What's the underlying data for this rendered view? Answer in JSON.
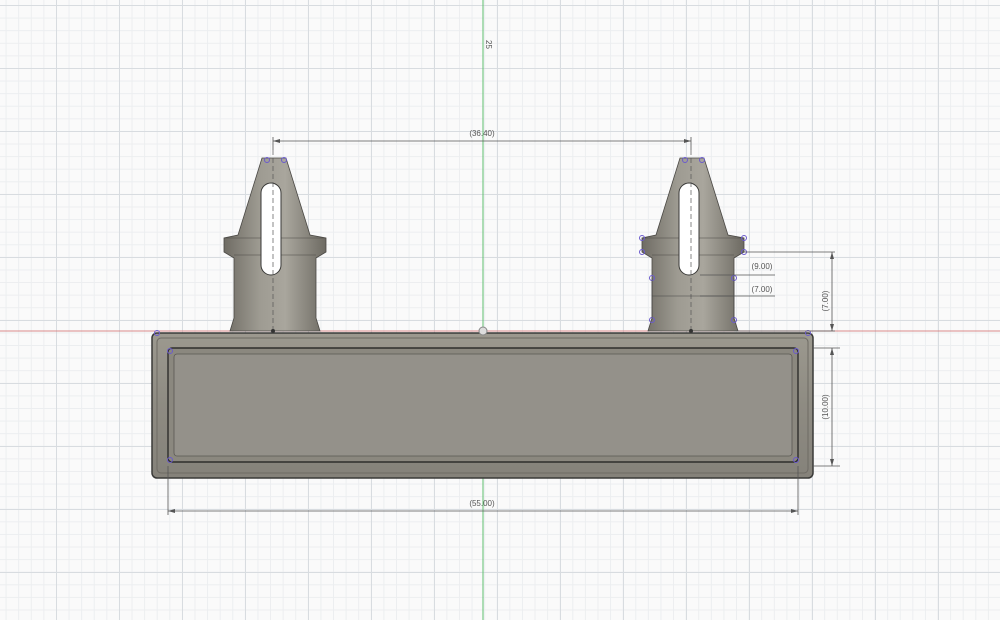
{
  "viewport": {
    "name": "sketch-viewport",
    "axis_label": "25",
    "colors": {
      "grid_major": "#d8dce0",
      "grid_minor": "#eceef0",
      "axis_vertical": "#5fbf6f",
      "axis_horizontal": "#d98a8a",
      "part_body": "#8f8c83",
      "part_edge": "#3a3a38",
      "dimension_line": "#555555",
      "constraint": "#6a5acd"
    }
  },
  "dimensions": {
    "pin_spacing": "(36.40)",
    "slot_upper": "(9.00)",
    "slot_lower": "(7.00)",
    "pin_height": "(7.00)",
    "base_height": "(10.00)",
    "base_width": "(55.00)"
  }
}
